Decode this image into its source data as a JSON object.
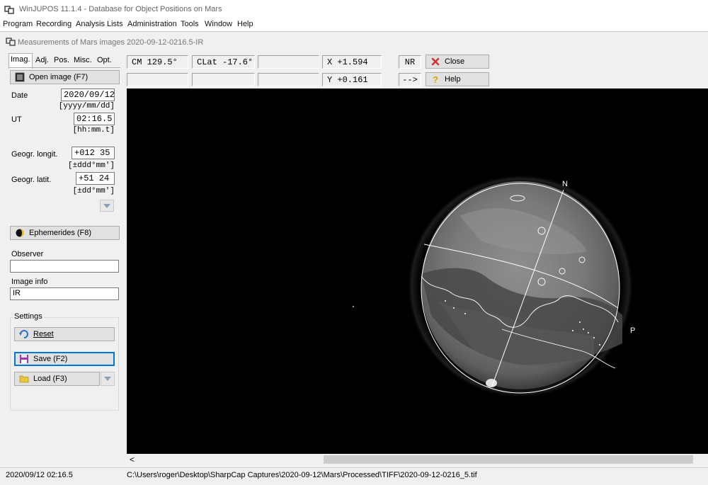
{
  "app": {
    "title": "WinJUPOS 11.1.4 - Database for Object Positions on Mars",
    "menu": [
      "Program",
      "Recording",
      "Analysis",
      "Lists",
      "Administration",
      "Tools",
      "Window",
      "Help"
    ]
  },
  "child_window": {
    "title": "Measurements of Mars images  2020-09-12-0216.5-IR"
  },
  "left_panel": {
    "tabs": [
      "Imag.",
      "Adj.",
      "Pos.",
      "Misc.",
      "Opt."
    ],
    "open_image_label": "Open image (F7)",
    "date_label": "Date",
    "date_value": "2020/09/12",
    "date_hint": "[yyyy/mm/dd]",
    "ut_label": "UT",
    "ut_value": "02:16.5",
    "ut_hint": "[hh:mm.t]",
    "longit_label": "Geogr. longit.",
    "longit_value": "+012 35",
    "longit_hint": "[±ddd°mm']",
    "latit_label": "Geogr. latit.",
    "latit_value": "+51 24",
    "latit_hint": "[±dd°mm']",
    "ephemerides_label": "Ephemerides (F8)",
    "observer_label": "Observer",
    "observer_value": "",
    "image_info_label": "Image info",
    "image_info_value": "IR",
    "settings_label": "Settings",
    "reset_label": "Reset",
    "save_label": "Save (F2)",
    "load_label": "Load (F3)"
  },
  "readouts": {
    "cm": "CM  129.5°",
    "clat": "CLat -17.6°",
    "x": "X  +1.594",
    "y": "Y  +0.161",
    "nr": "NR",
    "arrow": "-->",
    "close_label": "Close",
    "help_label": "Help"
  },
  "image": {
    "north_label": "N",
    "p_label": "P"
  },
  "scrollbar": {
    "left_arrow": "<"
  },
  "status": {
    "datetime": "2020/09/12   02:16.5",
    "path": "C:\\Users\\roger\\Desktop\\SharpCap Captures\\2020-09-12\\Mars\\Processed\\TIFF\\2020-09-12-0216_5.tif"
  },
  "colors": {
    "close_icon": "#d23030",
    "help_icon": "#e0a000",
    "focus_border": "#0078d7"
  }
}
